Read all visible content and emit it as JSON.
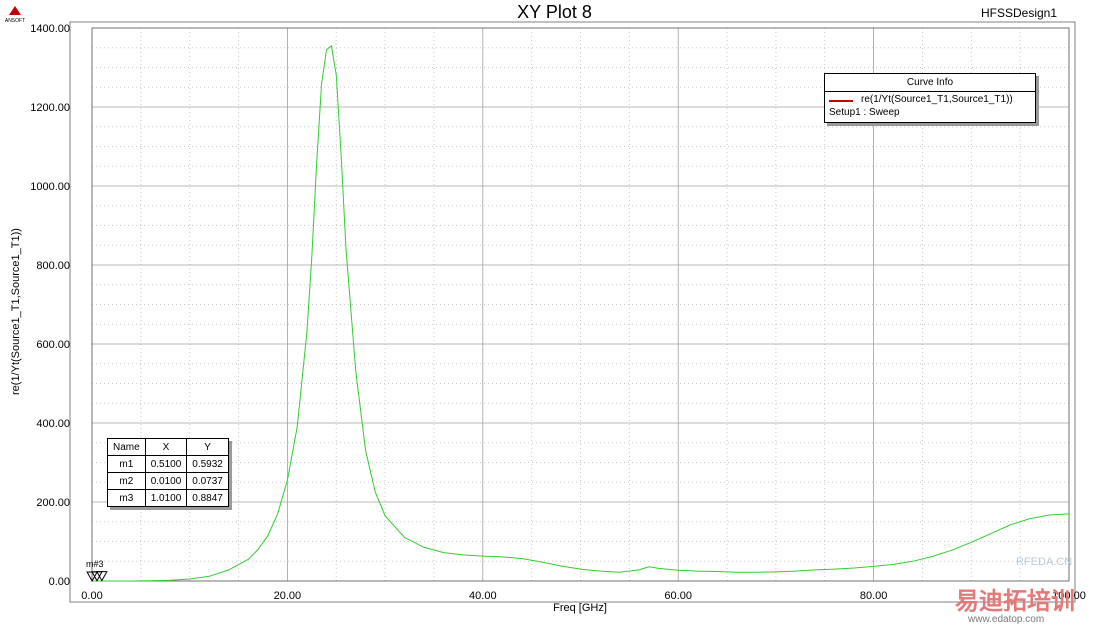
{
  "window": {
    "title": "XY Plot 8",
    "design": "HFSSDesign1",
    "logo_text": "ANSOFT"
  },
  "legend": {
    "title": "Curve Info",
    "entries": [
      {
        "name": "re(1/Yt(Source1_T1,Source1_T1))",
        "sub": "Setup1 : Sweep",
        "color": "#cc0000"
      }
    ]
  },
  "markers": {
    "headers": [
      "Name",
      "X",
      "Y"
    ],
    "rows": [
      [
        "m1",
        "0.5100",
        "0.5932"
      ],
      [
        "m2",
        "0.0100",
        "0.0737"
      ],
      [
        "m3",
        "1.0100",
        "0.8847"
      ]
    ],
    "label": "m#3"
  },
  "watermark": {
    "site": "RFEDA.CN",
    "brand": "易迪拓培训",
    "url": "www.edatop.com"
  },
  "chart_data": {
    "type": "line",
    "title": "XY Plot 8",
    "xlabel": "Freq [GHz]",
    "ylabel": "re(1/Yt(Source1_T1,Source1_T1))",
    "xlim": [
      0,
      100
    ],
    "ylim": [
      0,
      1400
    ],
    "xticks": [
      "0.00",
      "20.00",
      "40.00",
      "60.00",
      "80.00",
      "100.00"
    ],
    "yticks": [
      "0.00",
      "200.00",
      "400.00",
      "600.00",
      "800.00",
      "1000.00",
      "1200.00",
      "1400.00"
    ],
    "grid": true,
    "legend_position": "top-right",
    "series": [
      {
        "name": "re(1/Yt(Source1_T1,Source1_T1))",
        "color": "#33cc33",
        "x": [
          0,
          4,
          6,
          8,
          10,
          12,
          14,
          16,
          17,
          18,
          19,
          20,
          21,
          22,
          22.5,
          23,
          23.5,
          24,
          24.5,
          25,
          25.5,
          26,
          27,
          28,
          29,
          30,
          32,
          34,
          36,
          38,
          40,
          42,
          44,
          46,
          48,
          50,
          52,
          54,
          56,
          57,
          58,
          60,
          62,
          64,
          66,
          68,
          70,
          72,
          74,
          76,
          78,
          80,
          82,
          84,
          86,
          88,
          90,
          92,
          94,
          96,
          98,
          100
        ],
        "y": [
          0,
          0,
          0.5,
          2,
          5,
          12,
          28,
          55,
          80,
          115,
          170,
          255,
          390,
          630,
          820,
          1060,
          1260,
          1345,
          1355,
          1280,
          1080,
          840,
          530,
          330,
          225,
          165,
          110,
          85,
          72,
          66,
          63,
          61,
          57,
          48,
          38,
          30,
          25,
          22,
          28,
          36,
          32,
          27,
          25,
          24,
          22,
          22,
          23,
          25,
          28,
          30,
          33,
          37,
          42,
          50,
          62,
          78,
          98,
          120,
          142,
          158,
          167,
          170
        ]
      }
    ],
    "markers": [
      {
        "name": "m1",
        "x": 0.51,
        "y": 0.5932
      },
      {
        "name": "m2",
        "x": 0.01,
        "y": 0.0737
      },
      {
        "name": "m3",
        "x": 1.01,
        "y": 0.8847
      }
    ]
  }
}
